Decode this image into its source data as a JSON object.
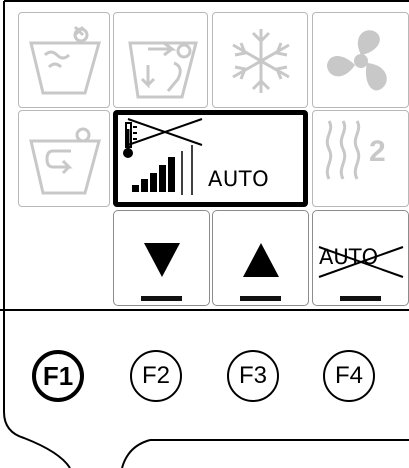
{
  "display": {
    "auto_text": "AUTO"
  },
  "tiles": {
    "seat_heat_badge": "2"
  },
  "buttons": {
    "auto_label": "AUTO"
  },
  "function_keys": [
    "F1",
    "F2",
    "F3",
    "F4"
  ],
  "active_function_key": "F1",
  "colors": {
    "disabled_icon": "#c8c8c8",
    "active_border": "#000000"
  },
  "icons": [
    "windshield-defrost-icon",
    "airflow-body-feet-icon",
    "snowflake-icon",
    "fan-icon",
    "recirculation-icon",
    "thermometer-icon",
    "seat-heat-icon",
    "down-arrow-icon",
    "up-arrow-icon"
  ]
}
